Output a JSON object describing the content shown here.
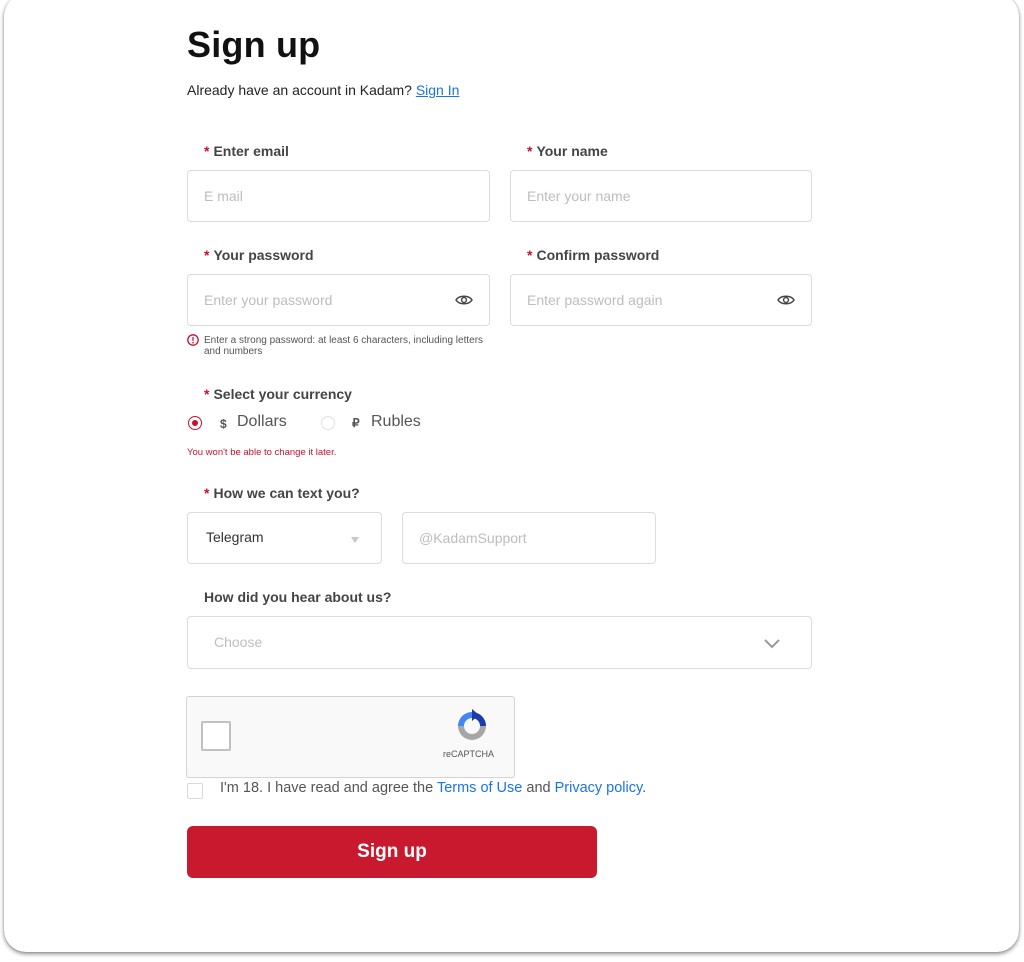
{
  "header": {
    "title": "Sign up",
    "subtitle_text": "Already have an account in Kadam? ",
    "sign_in_link": "Sign In"
  },
  "form": {
    "required_mark": "*",
    "email": {
      "label": "Enter email",
      "placeholder": "E mail",
      "value": ""
    },
    "name": {
      "label": "Your name",
      "placeholder": "Enter your name",
      "value": ""
    },
    "password": {
      "label": "Your password",
      "placeholder": "Enter your password",
      "value": "",
      "hint": "Enter a strong password: at least 6 characters, including letters and numbers"
    },
    "confirm_password": {
      "label": "Confirm password",
      "placeholder": "Enter password again",
      "value": ""
    },
    "currency": {
      "label": "Select your currency",
      "options": [
        {
          "symbol": "$",
          "label": "Dollars",
          "selected": true
        },
        {
          "symbol": "₽",
          "label": "Rubles",
          "selected": false
        }
      ],
      "warning": "You won't be able to change it later."
    },
    "contact": {
      "label": "How we can text you?",
      "method_selected": "Telegram",
      "handle_placeholder": "@KadamSupport",
      "handle_value": ""
    },
    "referral": {
      "label": "How did you hear about us?",
      "placeholder": "Choose"
    },
    "captcha": {
      "brand": "reCAPTCHA",
      "checked": false
    },
    "agreement": {
      "checked": false,
      "text_before": "I'm 18. I have read and agree the ",
      "terms_link": "Terms of Use",
      "text_middle": " and ",
      "privacy_link": "Privacy policy",
      "text_after": "."
    },
    "submit_label": "Sign up"
  },
  "colors": {
    "accent": "#c8192f",
    "link": "#1a73e8",
    "border": "#dcdcdc"
  }
}
